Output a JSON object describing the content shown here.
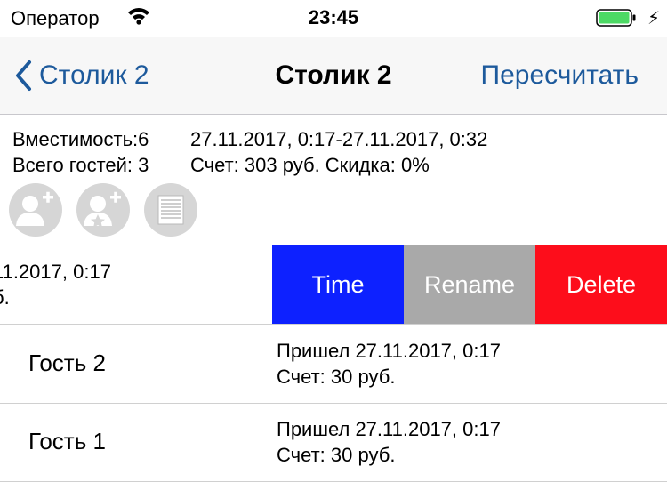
{
  "status": {
    "carrier": "Оператор",
    "time": "23:45",
    "battery_color": "#4cd964"
  },
  "nav": {
    "back_label": "Столик 2",
    "title": "Столик 2",
    "right_button": "Пересчитать",
    "accent_color": "#1d5a9c"
  },
  "table_info": {
    "capacity": "Вместимость:6",
    "period": "27.11.2017, 0:17-27.11.2017, 0:32",
    "guests_total": "Всего гостей: 3",
    "bill": "Счет: 303 руб. Скидка: 0%"
  },
  "actions": [
    {
      "icon": "add-guest-icon"
    },
    {
      "icon": "add-vip-guest-icon"
    },
    {
      "icon": "document-icon"
    }
  ],
  "swiped_row": {
    "line1": "11.2017, 0:17",
    "line2": "б.",
    "buttons": [
      {
        "label": "Time",
        "color": "#0d21ff"
      },
      {
        "label": "Rename",
        "color": "#a9a9a9"
      },
      {
        "label": "Delete",
        "color": "#fd0d1b"
      }
    ]
  },
  "guests": [
    {
      "name": "Гость 2",
      "arrived": "Пришел 27.11.2017, 0:17",
      "bill": "Счет: 30 руб."
    },
    {
      "name": "Гость 1",
      "arrived": "Пришел 27.11.2017, 0:17",
      "bill": "Счет: 30 руб."
    }
  ]
}
